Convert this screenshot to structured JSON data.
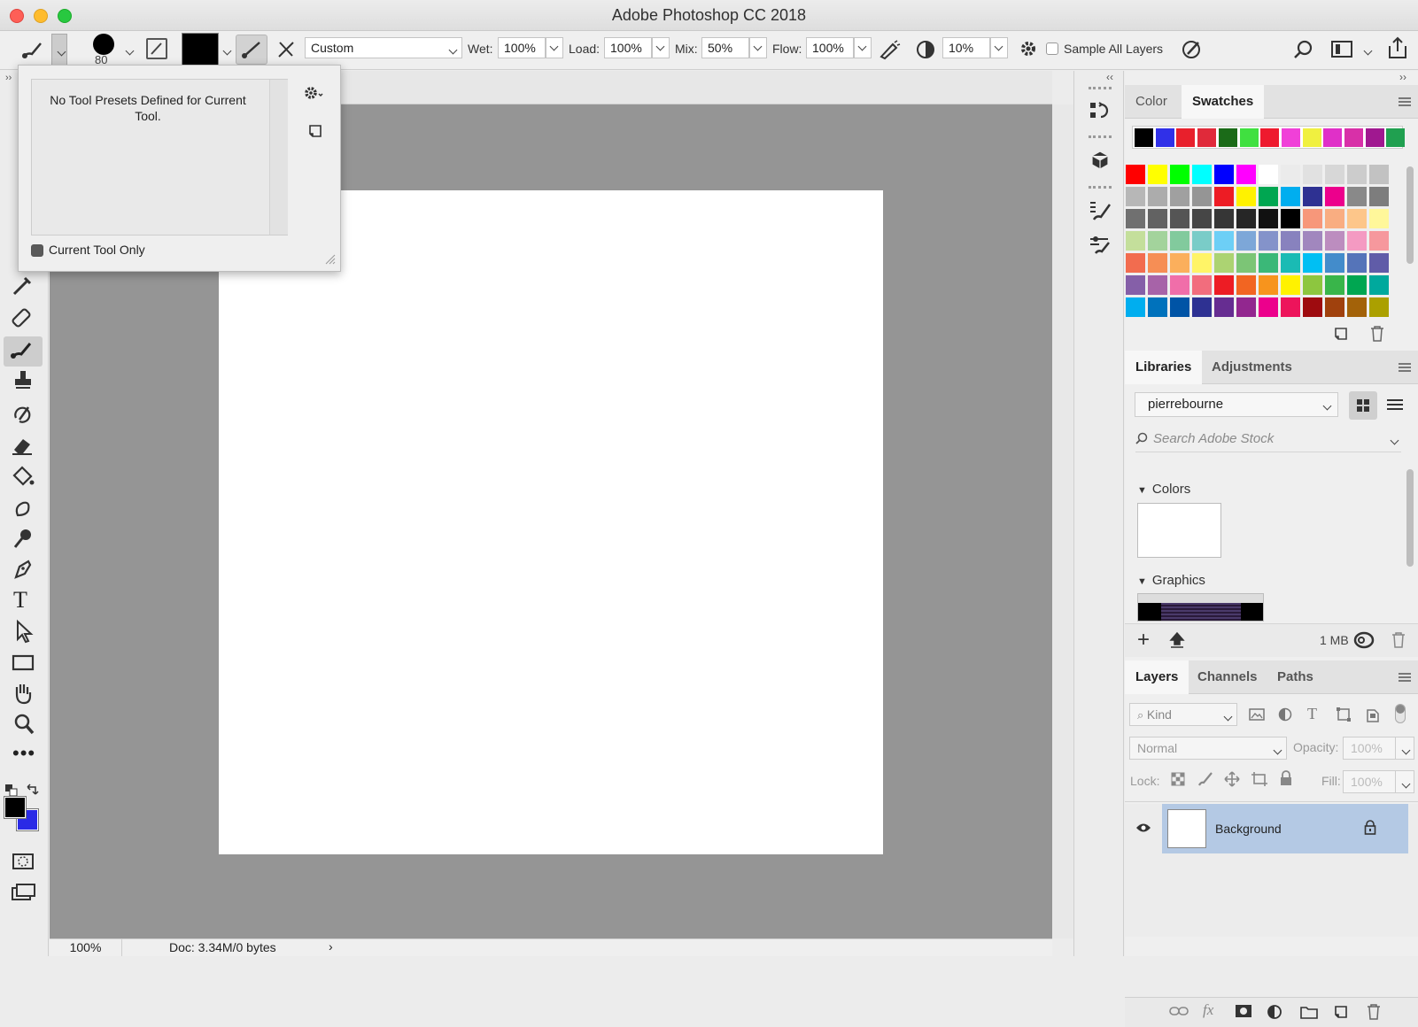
{
  "window": {
    "title": "Adobe Photoshop CC 2018"
  },
  "colors": {
    "accent": "#b4c9e4",
    "canvas_bg": "#959595",
    "foreground": "#000000",
    "background": "#2a2ae6"
  },
  "options_bar": {
    "brush_size": "80",
    "preset_mode": "Custom",
    "wet_label": "Wet:",
    "wet_value": "100%",
    "load_label": "Load:",
    "load_value": "100%",
    "mix_label": "Mix:",
    "mix_value": "50%",
    "flow_label": "Flow:",
    "flow_value": "100%",
    "smoothing_value": "10%",
    "sample_all_layers_label": "Sample All Layers"
  },
  "tool_presets_popup": {
    "message": "No Tool Presets Defined for Current Tool.",
    "current_tool_only_label": "Current Tool Only",
    "current_tool_only_checked": true
  },
  "status_bar": {
    "zoom": "100%",
    "doc_info": "Doc: 3.34M/0 bytes"
  },
  "color_panel": {
    "tabs": [
      "Color",
      "Swatches"
    ],
    "active_tab": "Swatches",
    "recent_swatches": [
      "#000000",
      "#3030e8",
      "#e8202c",
      "#e02a3a",
      "#1b6b18",
      "#40e040",
      "#ee1a2e",
      "#f040d8",
      "#f0f040",
      "#e030c8",
      "#d830a8",
      "#a01890",
      "#20a050"
    ],
    "swatch_rows": [
      [
        "#ff0000",
        "#ffff00",
        "#00ff00",
        "#00ffff",
        "#0000ff",
        "#ff00ff",
        "#ffffff",
        "#ebebeb",
        "#e1e1e1",
        "#d7d7d7",
        "#cccccc",
        "#c2c2c2"
      ],
      [
        "#b7b7b7",
        "#acacac",
        "#a0a0a0",
        "#959595",
        "#ed1c24",
        "#fff200",
        "#00a651",
        "#00aeef",
        "#2e3192",
        "#ec008c",
        "#898989",
        "#7d7d7d"
      ],
      [
        "#707070",
        "#626262",
        "#555555",
        "#464646",
        "#363636",
        "#262626",
        "#111111",
        "#000000",
        "#f7977a",
        "#f9ad81",
        "#fdc68a",
        "#fff79a"
      ],
      [
        "#c4df9b",
        "#a3d39c",
        "#82ca9d",
        "#7accc8",
        "#6dcff6",
        "#7da7d8",
        "#8493ca",
        "#8882be",
        "#a187be",
        "#bc8dbf",
        "#f49ac2",
        "#f6989d"
      ],
      [
        "#f26c4f",
        "#f68e55",
        "#fbaf5c",
        "#fff467",
        "#acd372",
        "#7cc576",
        "#3bb878",
        "#1abbb4",
        "#00bff3",
        "#438ccb",
        "#5574b9",
        "#605ca8"
      ],
      [
        "#855fa8",
        "#a763a8",
        "#f06ea9",
        "#f26d7d",
        "#ed1c24",
        "#f26522",
        "#f7941d",
        "#fff200",
        "#8dc63f",
        "#39b54a",
        "#00a651",
        "#00a99d"
      ],
      [
        "#00aeef",
        "#0072bc",
        "#0054a6",
        "#2e3192",
        "#662d91",
        "#92278f",
        "#ec008c",
        "#ed145b",
        "#9e0b0f",
        "#a0410d",
        "#a36209",
        "#aba000"
      ]
    ]
  },
  "libraries_panel": {
    "tabs": [
      "Libraries",
      "Adjustments"
    ],
    "active_tab": "Libraries",
    "library_name": "pierrebourne",
    "search_placeholder": "Search Adobe Stock",
    "colors_section": "Colors",
    "graphics_section": "Graphics",
    "storage": "1 MB"
  },
  "layers_panel": {
    "tabs": [
      "Layers",
      "Channels",
      "Paths"
    ],
    "active_tab": "Layers",
    "filter_kind": "Kind",
    "blend_mode": "Normal",
    "opacity_label": "Opacity:",
    "opacity_value": "100%",
    "lock_label": "Lock:",
    "fill_label": "Fill:",
    "fill_value": "100%",
    "layers": [
      {
        "name": "Background",
        "visible": true,
        "locked": true
      }
    ]
  }
}
